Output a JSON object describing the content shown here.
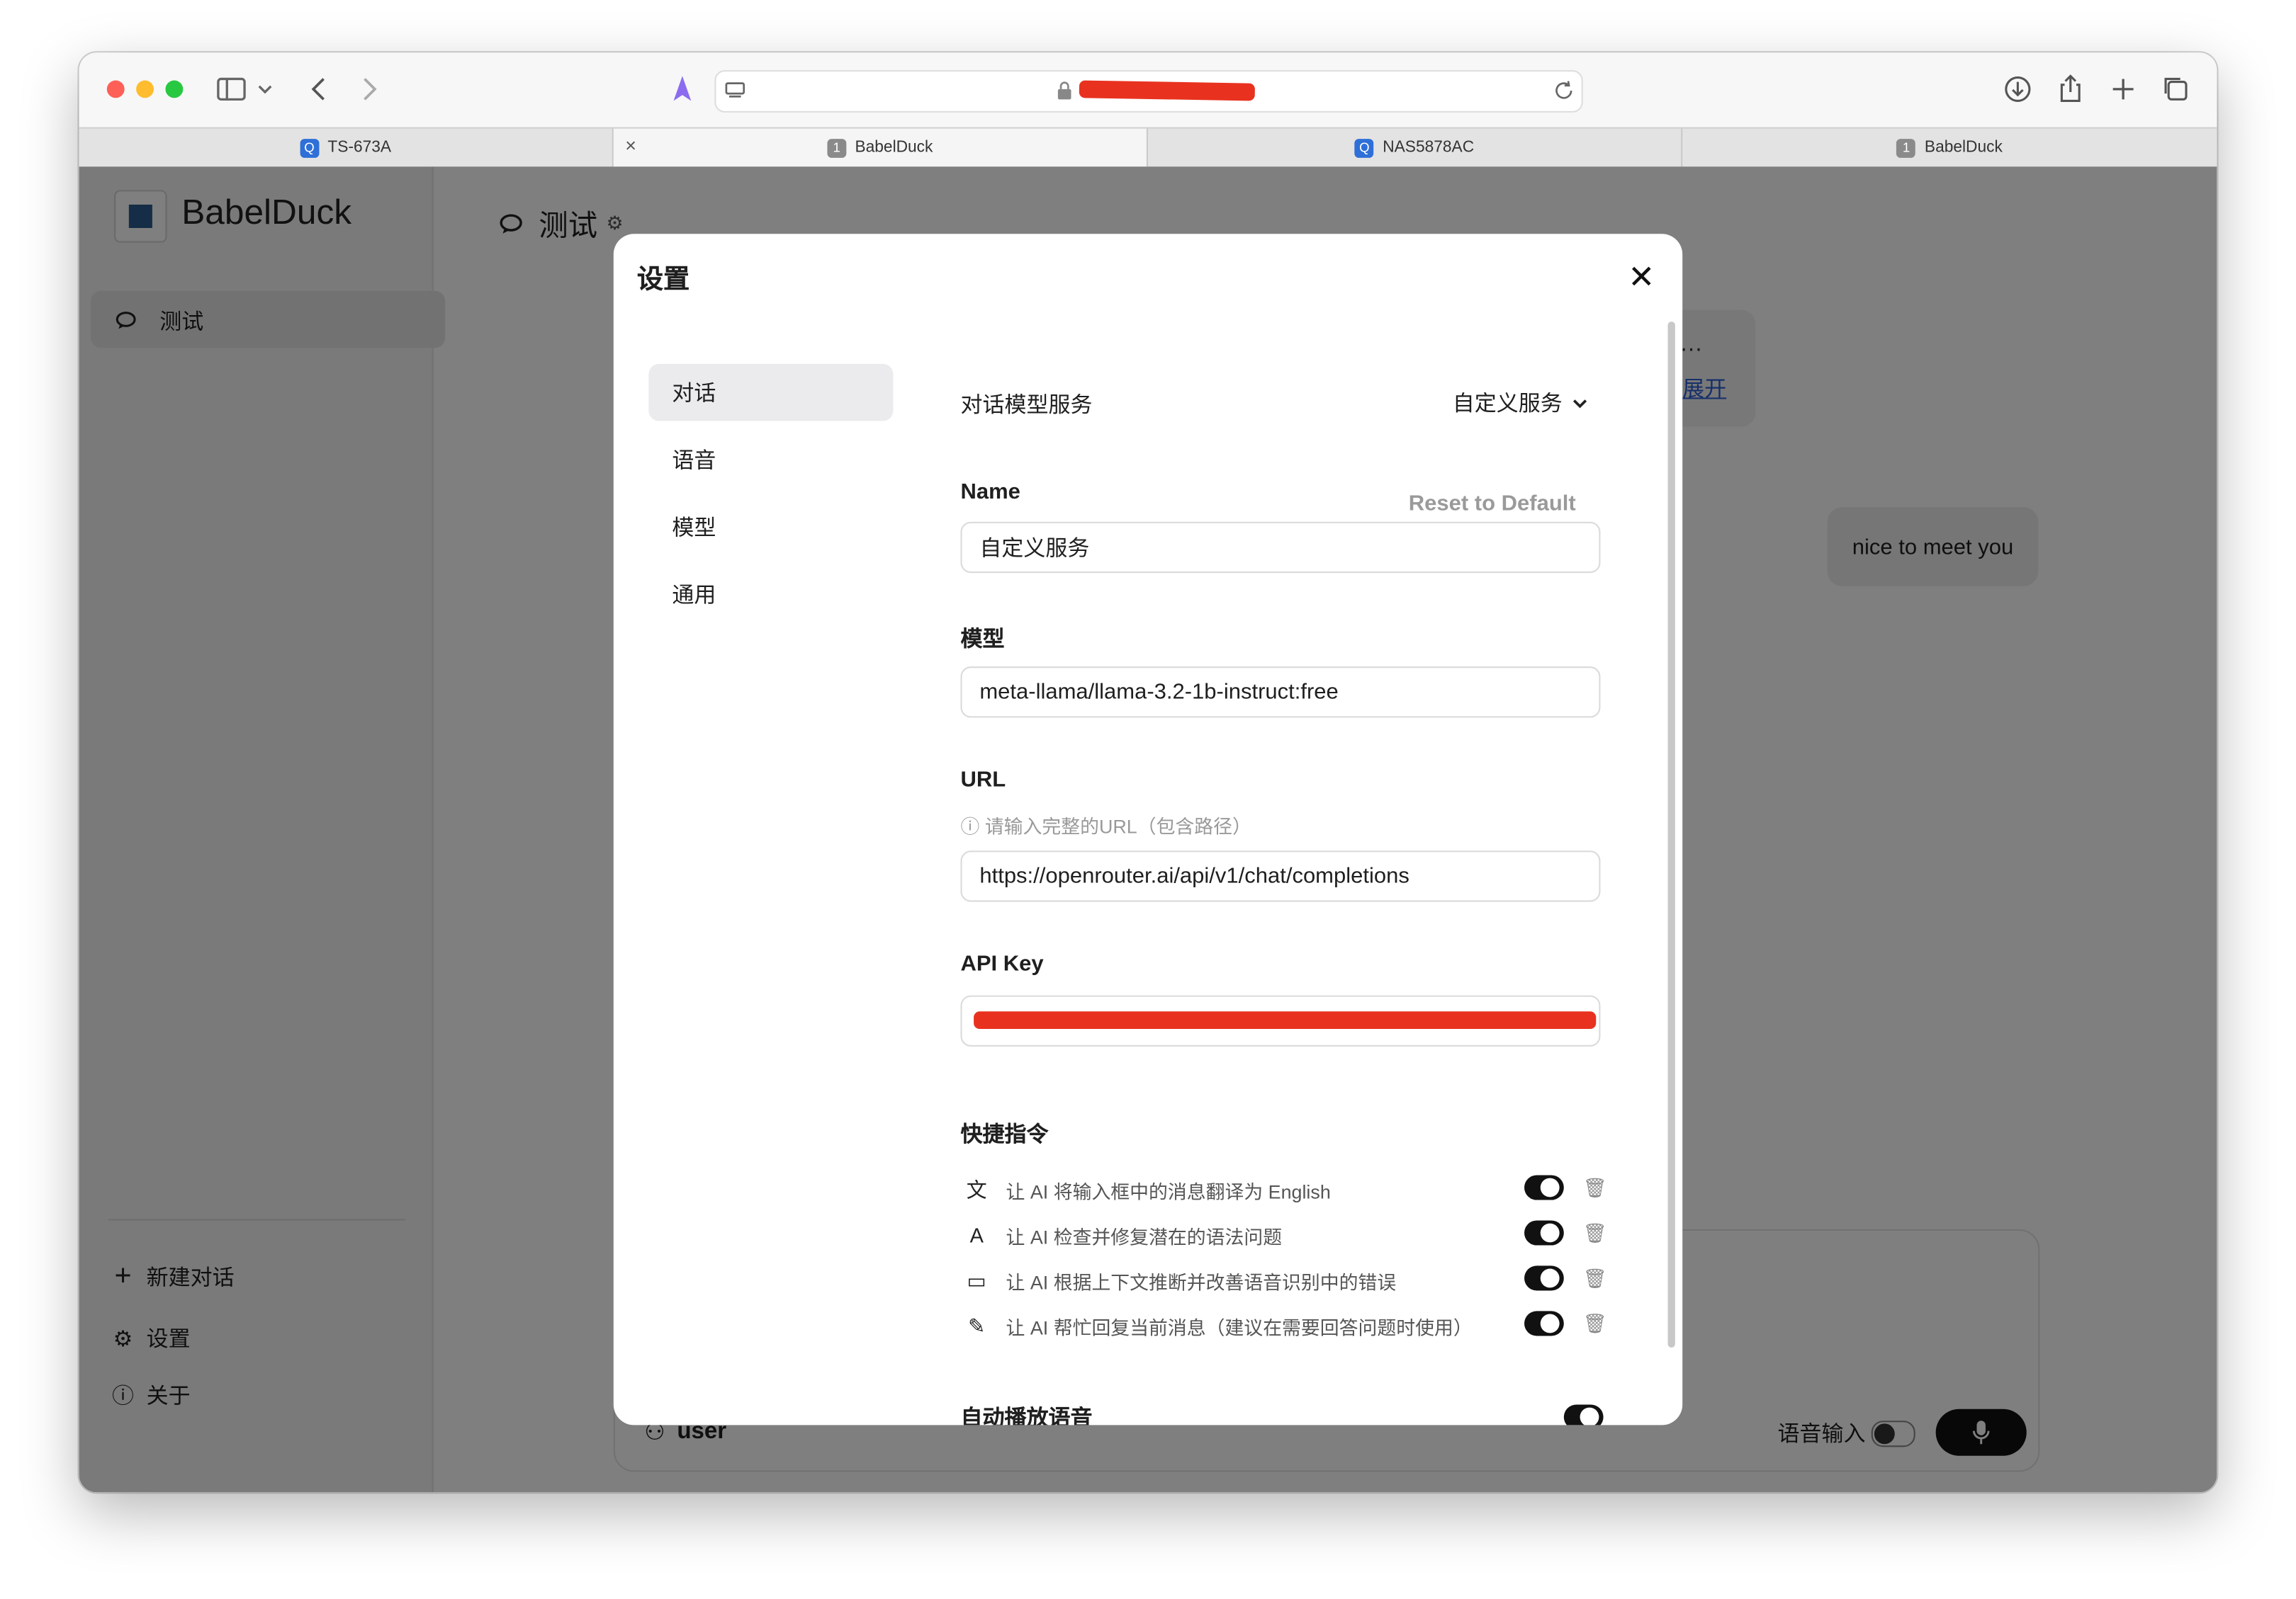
{
  "browser": {
    "tabs": [
      {
        "label": "TS-673A",
        "favicon": "Q"
      },
      {
        "label": "BabelDuck",
        "favicon": "1",
        "close": "×"
      },
      {
        "label": "NAS5878AC",
        "favicon": "Q"
      },
      {
        "label": "BabelDuck",
        "favicon": "1"
      }
    ]
  },
  "sidebar": {
    "brand": "BabelDuck",
    "conversation": "测试",
    "new_chat": "新建对话",
    "settings": "设置",
    "about": "关于"
  },
  "main": {
    "title": "测试",
    "bubble_left_line1": "…",
    "bubble_left_link": "展开",
    "bubble_right": "nice to meet you",
    "user_label": "user",
    "voice_input": "语音输入"
  },
  "modal": {
    "title": "设置",
    "close": "✕",
    "nav": [
      "对话",
      "语音",
      "模型",
      "通用"
    ],
    "service_label": "对话模型服务",
    "service_value": "自定义服务",
    "name_label": "Name",
    "reset": "Reset to Default",
    "name_value": "自定义服务",
    "model_label": "模型",
    "model_value": "meta-llama/llama-3.2-1b-instruct:free",
    "url_label": "URL",
    "url_hint": "ⓘ 请输入完整的URL（包含路径）",
    "url_value": "https://openrouter.ai/api/v1/chat/completions",
    "api_key_label": "API Key",
    "shortcuts_label": "快捷指令",
    "shortcuts": [
      {
        "icon": "translate-icon",
        "glyph": "文",
        "text": "让 AI 将输入框中的消息翻译为 English",
        "enabled": true
      },
      {
        "icon": "spellcheck-icon",
        "glyph": "A",
        "text": "让 AI 检查并修复潜在的语法问题",
        "enabled": true
      },
      {
        "icon": "speech-fix-icon",
        "glyph": "▭",
        "text": "让 AI 根据上下文推断并改善语音识别中的错误",
        "enabled": true
      },
      {
        "icon": "pen-icon",
        "glyph": "✎",
        "text": "让 AI 帮忙回复当前消息（建议在需要回答问题时使用）",
        "enabled": true
      }
    ],
    "autoplay_label": "自动播放语音"
  },
  "colors": {
    "redaction": "#e8321f",
    "link": "#2d5fd3",
    "overlay": "rgba(0,0,0,0.5)"
  }
}
